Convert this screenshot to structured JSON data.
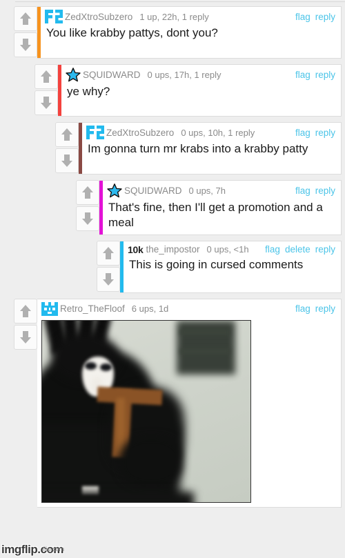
{
  "page": {
    "background_color": "#eeeeee",
    "watermark": "imgflip.com",
    "watermark_sub": "flip.com"
  },
  "colors": {
    "link": "#4bc4e8",
    "username": "#8a8a8a",
    "text": "#1a1a1a",
    "card_bg": "#ffffff",
    "card_border": "#dcdcdc",
    "arrow": "#b0b0b0"
  },
  "icons": {
    "upvote": "arrow-up-icon",
    "downvote": "arrow-down-icon",
    "avatar_f2": "f2-logo-avatar-icon",
    "avatar_star": "star-avatar-icon",
    "avatar_cat": "pixel-cat-avatar-icon"
  },
  "comments": [
    {
      "id": "c1",
      "indent": 0,
      "accent_color": "#f7931e",
      "avatar": "f2",
      "username": "ZedXtroSubzero",
      "stats": "1 up, 22h, 1 reply",
      "actions": [
        "flag",
        "reply"
      ],
      "text": "You like krabby pattys, dont you?",
      "has_image": false
    },
    {
      "id": "c2",
      "indent": 1,
      "accent_color": "#f4423e",
      "avatar": "star",
      "username": "SQUIDWARD",
      "stats": "0 ups, 17h, 1 reply",
      "actions": [
        "flag",
        "reply"
      ],
      "text": "ye why?",
      "has_image": false
    },
    {
      "id": "c3",
      "indent": 2,
      "accent_color": "#8a4a44",
      "avatar": "f2",
      "username": "ZedXtroSubzero",
      "stats": "0 ups, 10h, 1 reply",
      "actions": [
        "flag",
        "reply"
      ],
      "text": "Im gonna turn mr krabs into a krabby patty",
      "has_image": false
    },
    {
      "id": "c4",
      "indent": 3,
      "accent_color": "#e312d6",
      "avatar": "star",
      "username": "SQUIDWARD",
      "stats": "0 ups, 7h",
      "actions": [
        "flag",
        "reply"
      ],
      "text": "That's fine, then I'll get a promotion and a meal",
      "has_image": false
    },
    {
      "id": "c5",
      "indent": 4,
      "accent_color": "#22baee",
      "avatar": "none",
      "badge": "10k",
      "username": "the_impostor",
      "stats": "0 ups, <1h",
      "actions": [
        "flag",
        "delete",
        "reply"
      ],
      "text": "This is going in cursed comments",
      "has_image": false
    },
    {
      "id": "c6",
      "indent": 0,
      "accent_color": "none",
      "avatar": "cat",
      "username": "Retro_TheFloof",
      "stats": "6 ups, 1d",
      "actions": [
        "flag",
        "reply"
      ],
      "text": "",
      "has_image": true,
      "image_alt": "masked figure in black holding a wooden cross"
    }
  ]
}
